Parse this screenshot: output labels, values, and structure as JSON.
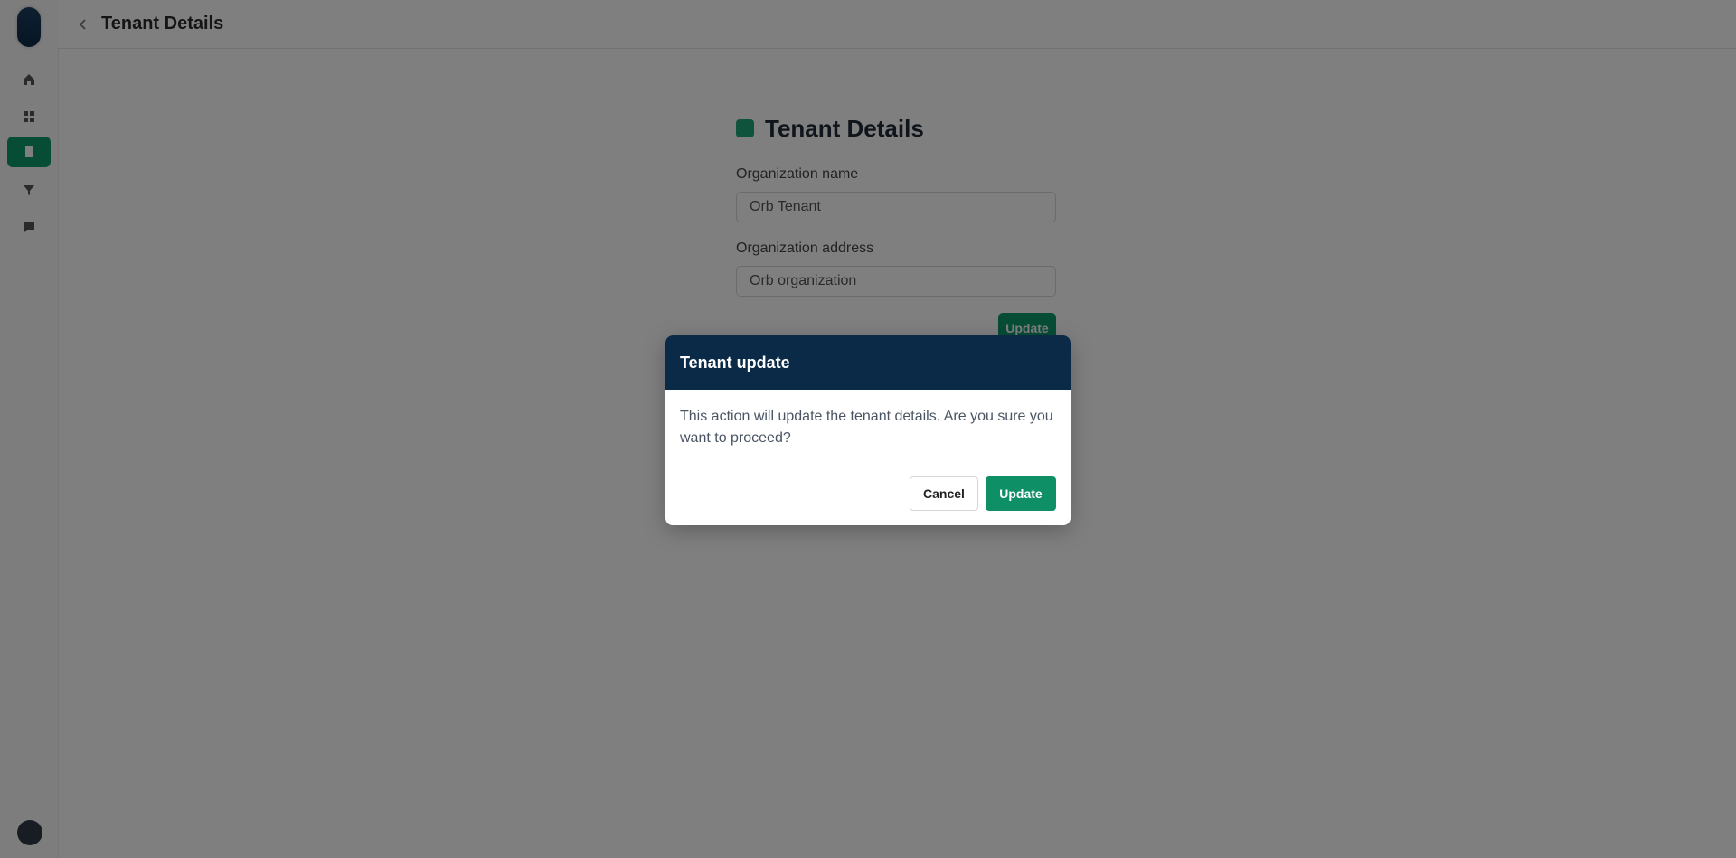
{
  "header": {
    "title": "Tenant Details"
  },
  "sidebar": {
    "items": [
      {
        "icon": "home-icon"
      },
      {
        "icon": "grid-icon"
      },
      {
        "icon": "building-icon",
        "active": true
      },
      {
        "icon": "filter-icon"
      },
      {
        "icon": "chat-icon"
      }
    ]
  },
  "form": {
    "heading": "Tenant Details",
    "fields": [
      {
        "label": "Organization name",
        "value": "Orb Tenant"
      },
      {
        "label": "Organization address",
        "value": "Orb organization"
      }
    ],
    "update_label": "Update"
  },
  "modal": {
    "title": "Tenant update",
    "message": "This action will update the tenant details. Are you sure you want to proceed?",
    "cancel_label": "Cancel",
    "update_label": "Update"
  },
  "colors": {
    "accent": "#0f8f65",
    "modal_header": "#0b2a47",
    "overlay": "rgba(0,0,0,0.5)"
  }
}
